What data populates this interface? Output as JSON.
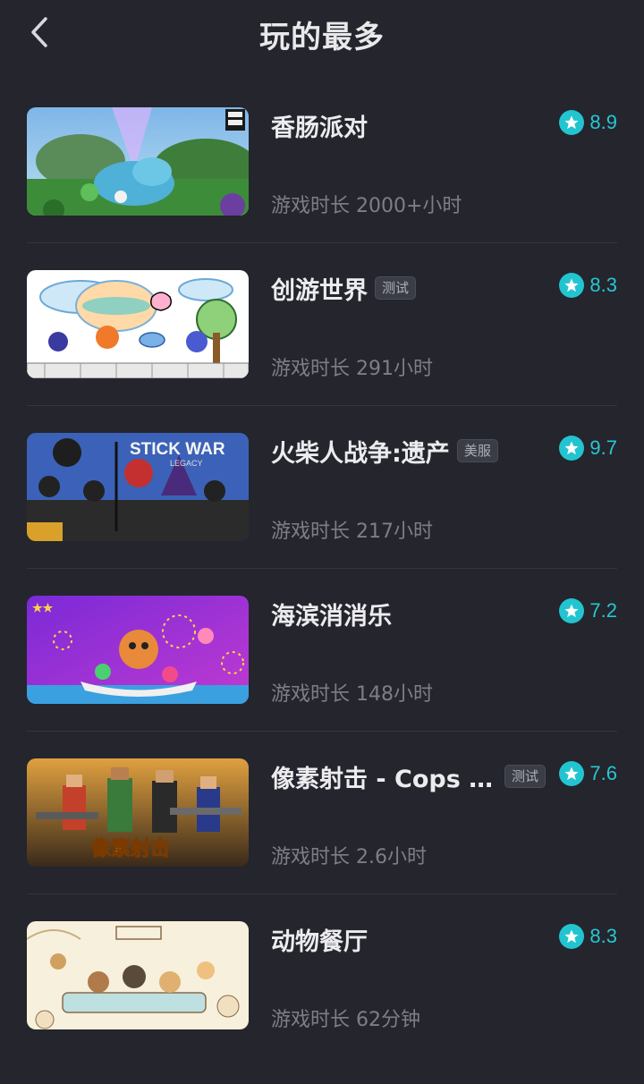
{
  "header": {
    "title": "玩的最多",
    "back_icon": "chevron-left-icon"
  },
  "accent_color": "#22c4cf",
  "games": [
    {
      "name": "香肠派对",
      "tag": "",
      "rating": "8.9",
      "playtime": "游戏时长 2000+小时"
    },
    {
      "name": "创游世界",
      "tag": "测试",
      "rating": "8.3",
      "playtime": "游戏时长 291小时"
    },
    {
      "name": "火柴人战争:遗产",
      "tag": "美服",
      "rating": "9.7",
      "playtime": "游戏时长 217小时",
      "thumb_text": "STICK WAR",
      "thumb_subtext": "LEGACY"
    },
    {
      "name": "海滨消消乐",
      "tag": "",
      "rating": "7.2",
      "playtime": "游戏时长 148小时"
    },
    {
      "name": "像素射击 - Cops N...",
      "tag": "测试",
      "rating": "7.6",
      "playtime": "游戏时长 2.6小时",
      "thumb_text": "像素射击"
    },
    {
      "name": "动物餐厅",
      "tag": "",
      "rating": "8.3",
      "playtime": "游戏时长 62分钟"
    }
  ]
}
